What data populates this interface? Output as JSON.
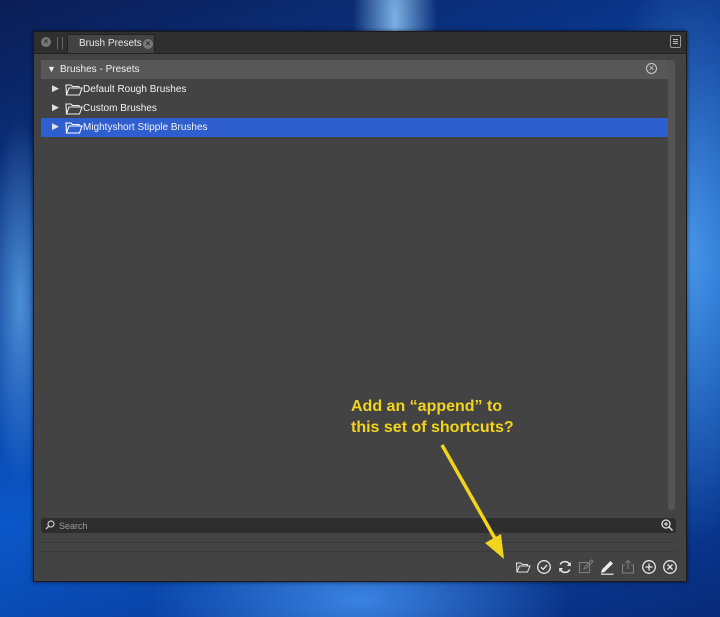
{
  "panel": {
    "tab_label": "Brush Presets",
    "tab_close_glyph": "×",
    "panel_close_glyph": "×"
  },
  "tree": {
    "header_label": "Brushes - Presets",
    "header_glyph": "▼",
    "header_close_glyph": "×",
    "items": [
      {
        "label": "Default Rough Brushes",
        "glyph": "▶",
        "selected": false
      },
      {
        "label": "Custom Brushes",
        "glyph": "▶",
        "selected": false
      },
      {
        "label": "Mightyshort Stipple Brushes",
        "glyph": "▶",
        "selected": true
      }
    ]
  },
  "search": {
    "placeholder": "Search"
  },
  "toolbar": {
    "icons": [
      "folder-open-icon",
      "checkmark-icon",
      "refresh-icon",
      "edit-icon",
      "pen-icon",
      "share-icon",
      "add-icon",
      "delete-icon"
    ]
  },
  "annotation": {
    "line1": "Add an “append” to",
    "line2": "this set of shortcuts?",
    "color": "#f2d41c"
  },
  "colors": {
    "selection": "#2f5fcf",
    "panel_bg": "#434343"
  }
}
